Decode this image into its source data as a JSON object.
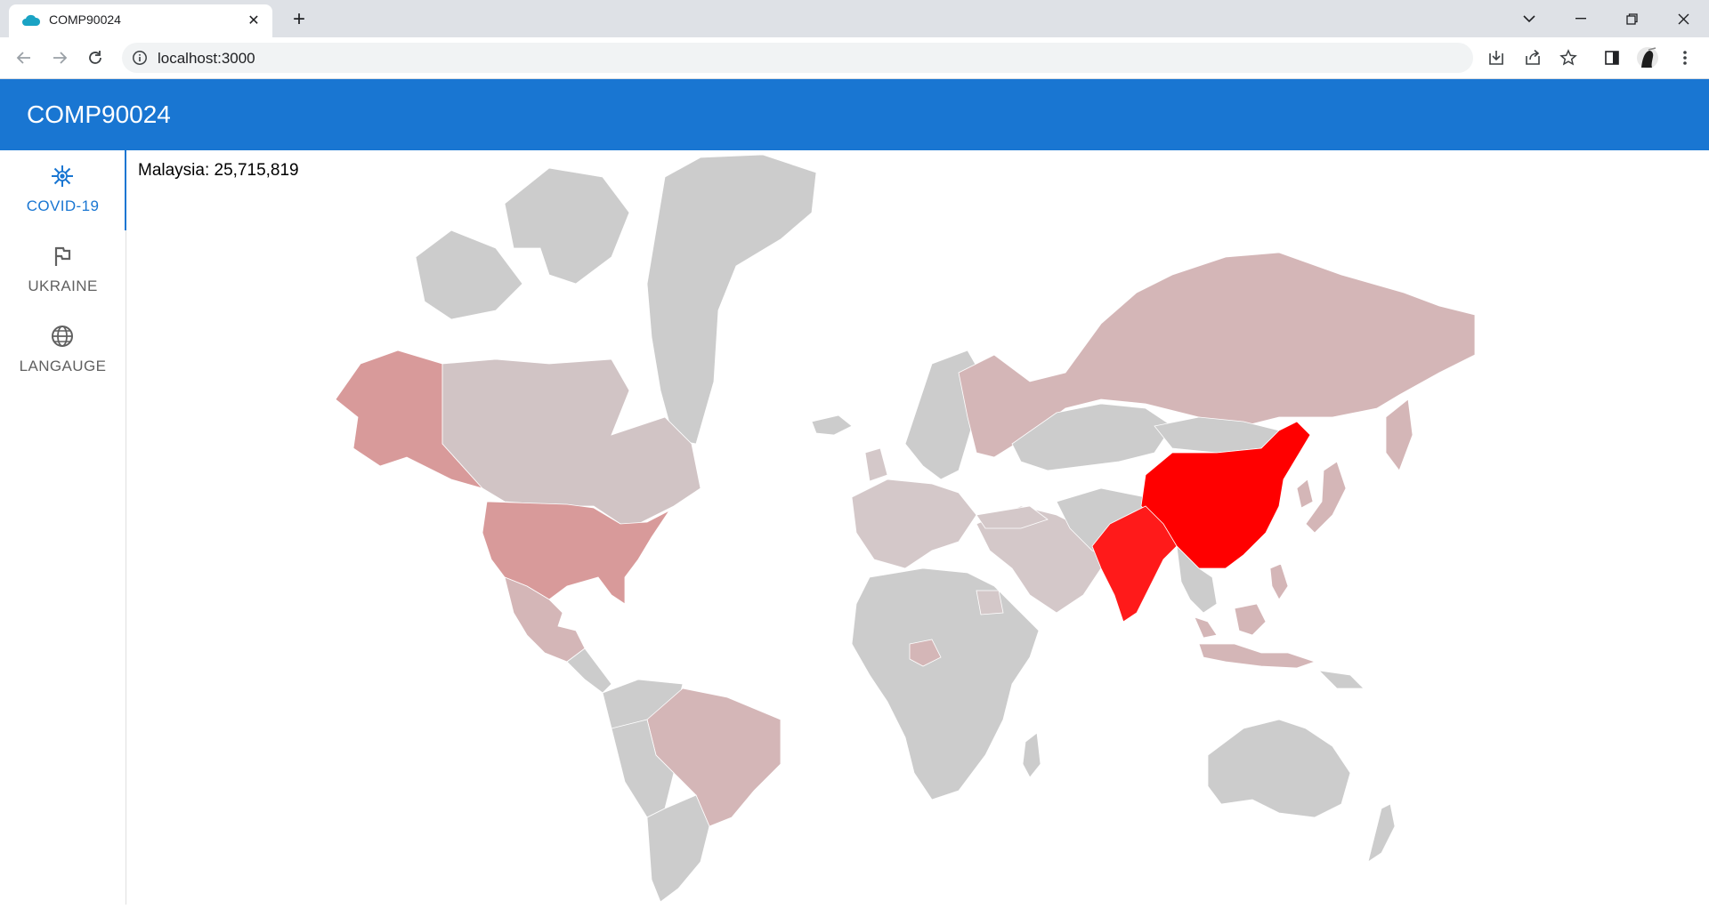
{
  "browser": {
    "tab_title": "COMP90024",
    "tab_close_glyph": "✕",
    "new_tab_glyph": "+",
    "url": "localhost:3000",
    "icons": [
      "cloud-favicon-icon",
      "back-arrow-icon",
      "forward-arrow-icon",
      "reload-icon",
      "info-icon",
      "install-app-icon",
      "share-icon",
      "bookmark-star-icon",
      "side-panel-icon",
      "profile-avatar",
      "kebab-menu-icon",
      "tab-search-icon",
      "minimize-icon",
      "restore-icon",
      "close-window-icon"
    ]
  },
  "app": {
    "title": "COMP90024",
    "accent_color": "#1976d2"
  },
  "sidenav": {
    "items": [
      {
        "label": "COVID-19",
        "icon": "virus-icon",
        "active": true
      },
      {
        "label": "UKRAINE",
        "icon": "flag-icon",
        "active": false
      },
      {
        "label": "LANGAUGE",
        "icon": "globe-icon",
        "active": false
      }
    ]
  },
  "map": {
    "hover_text": "Malaysia: 25,715,819",
    "scale_colors": {
      "none": "#cccccc",
      "low": "#d4b6b7",
      "medium": "#d89a9a",
      "high": "#ff1a1a",
      "max": "#ff0000"
    },
    "shaded_countries": [
      {
        "name": "China",
        "level": "max"
      },
      {
        "name": "India",
        "level": "high"
      },
      {
        "name": "United States",
        "level": "medium"
      },
      {
        "name": "Alaska (United States)",
        "level": "medium"
      },
      {
        "name": "Russia",
        "level": "low"
      },
      {
        "name": "Brazil",
        "level": "low"
      },
      {
        "name": "Mexico",
        "level": "low"
      },
      {
        "name": "Indonesia",
        "level": "low"
      },
      {
        "name": "Philippines",
        "level": "low"
      },
      {
        "name": "Malaysia",
        "level": "low"
      }
    ]
  }
}
